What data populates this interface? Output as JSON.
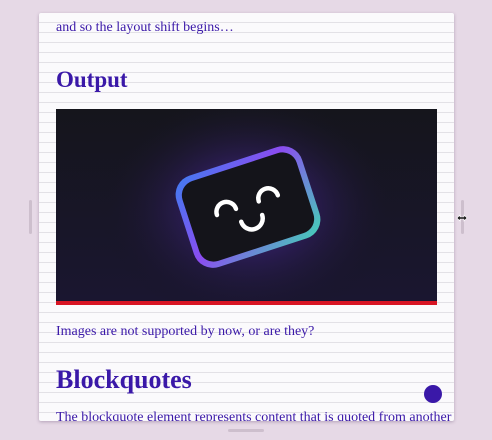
{
  "document": {
    "intro_text": "and so the layout shift begins…",
    "output_heading": "Output",
    "image_alt": "smiling rounded-square face logo",
    "image_caption_text": "Images are not supported by now, or are they?",
    "blockquotes_heading": "Blockquotes",
    "blockquote_text": "The blockquote element represents content that is quoted from another"
  },
  "colors": {
    "accent": "#3a18a8",
    "image_bar": "#d81524",
    "background": "#e6d9e6",
    "card": "#fbfafc"
  },
  "icons": {
    "resize": "horizontal-resize-icon",
    "image": "smiling-face-logo",
    "fab": "circle-button"
  }
}
